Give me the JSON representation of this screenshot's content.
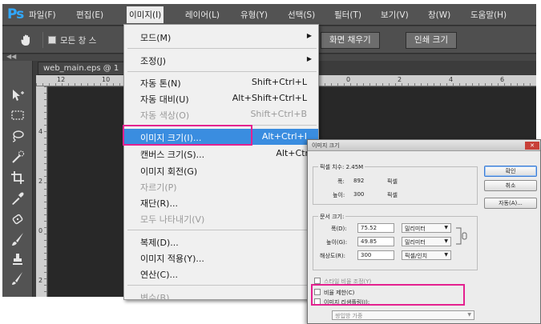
{
  "app": {
    "logo": "Ps",
    "menus": [
      "파일(F)",
      "편집(E)",
      "이미지(I)",
      "레이어(L)",
      "유형(Y)",
      "선택(S)",
      "필터(T)",
      "보기(V)",
      "창(W)",
      "도움말(H)"
    ]
  },
  "options_bar": {
    "checkbox_label": "모든 창 스",
    "fill_screen_button": "화면 채우기",
    "print_size_button": "인쇄 크기"
  },
  "document": {
    "tab_title": "web_main.eps @ 1",
    "ruler_top_ticks": [
      "12",
      "10",
      "0",
      "2",
      "4",
      "6"
    ],
    "ruler_left_ticks": [
      "4",
      "2",
      "0",
      "2",
      "4"
    ]
  },
  "image_menu": {
    "mode": "모드(M)",
    "adjustments": "조정(J)",
    "auto_tone": "자동 톤(N)",
    "auto_tone_sc": "Shift+Ctrl+L",
    "auto_contrast": "자동 대비(U)",
    "auto_contrast_sc": "Alt+Shift+Ctrl+L",
    "auto_color": "자동 색상(O)",
    "auto_color_sc": "Shift+Ctrl+B",
    "image_size": "이미지 크기(I)...",
    "image_size_sc": "Alt+Ctrl+I",
    "canvas_size": "캔버스 크기(S)...",
    "canvas_size_sc": "Alt+Ctrl+C",
    "image_rotation": "이미지 회전(G)",
    "crop": "자르기(P)",
    "trim": "재단(R)...",
    "reveal_all": "모두 나타내기(V)",
    "duplicate": "복제(D)...",
    "apply_image": "이미지 적용(Y)...",
    "calculations": "연산(C)...",
    "variables": "변수(B)"
  },
  "dialog": {
    "title": "이미지 크기",
    "ok": "확인",
    "cancel": "취소",
    "auto": "자동(A)...",
    "pixel_dimensions": "픽셀 치수: 2.45M",
    "pixel_width_label": "폭:",
    "pixel_width_value": "892",
    "pixel_height_label": "높이:",
    "pixel_height_value": "300",
    "pixel_unit": "픽셀",
    "document_size": "문서 크기:",
    "doc_width_label": "폭(D):",
    "doc_width_value": "75.52",
    "doc_height_label": "높이(G):",
    "doc_height_value": "49.85",
    "doc_resolution_label": "해상도(R):",
    "doc_resolution_value": "300",
    "unit_mm": "밀리미터",
    "unit_ppi": "픽셀/인치",
    "scale_styles": "스타일 비율 조정(Y)",
    "constrain_proportions": "비율 제한(C)",
    "resample_image": "이미지 리샘플링(I):",
    "resample_method": "쌍입방 가중"
  },
  "colors": {
    "highlight_box": "#e4218f",
    "menu_selection": "#3a8de0",
    "ps_logo": "#31a8ff"
  }
}
